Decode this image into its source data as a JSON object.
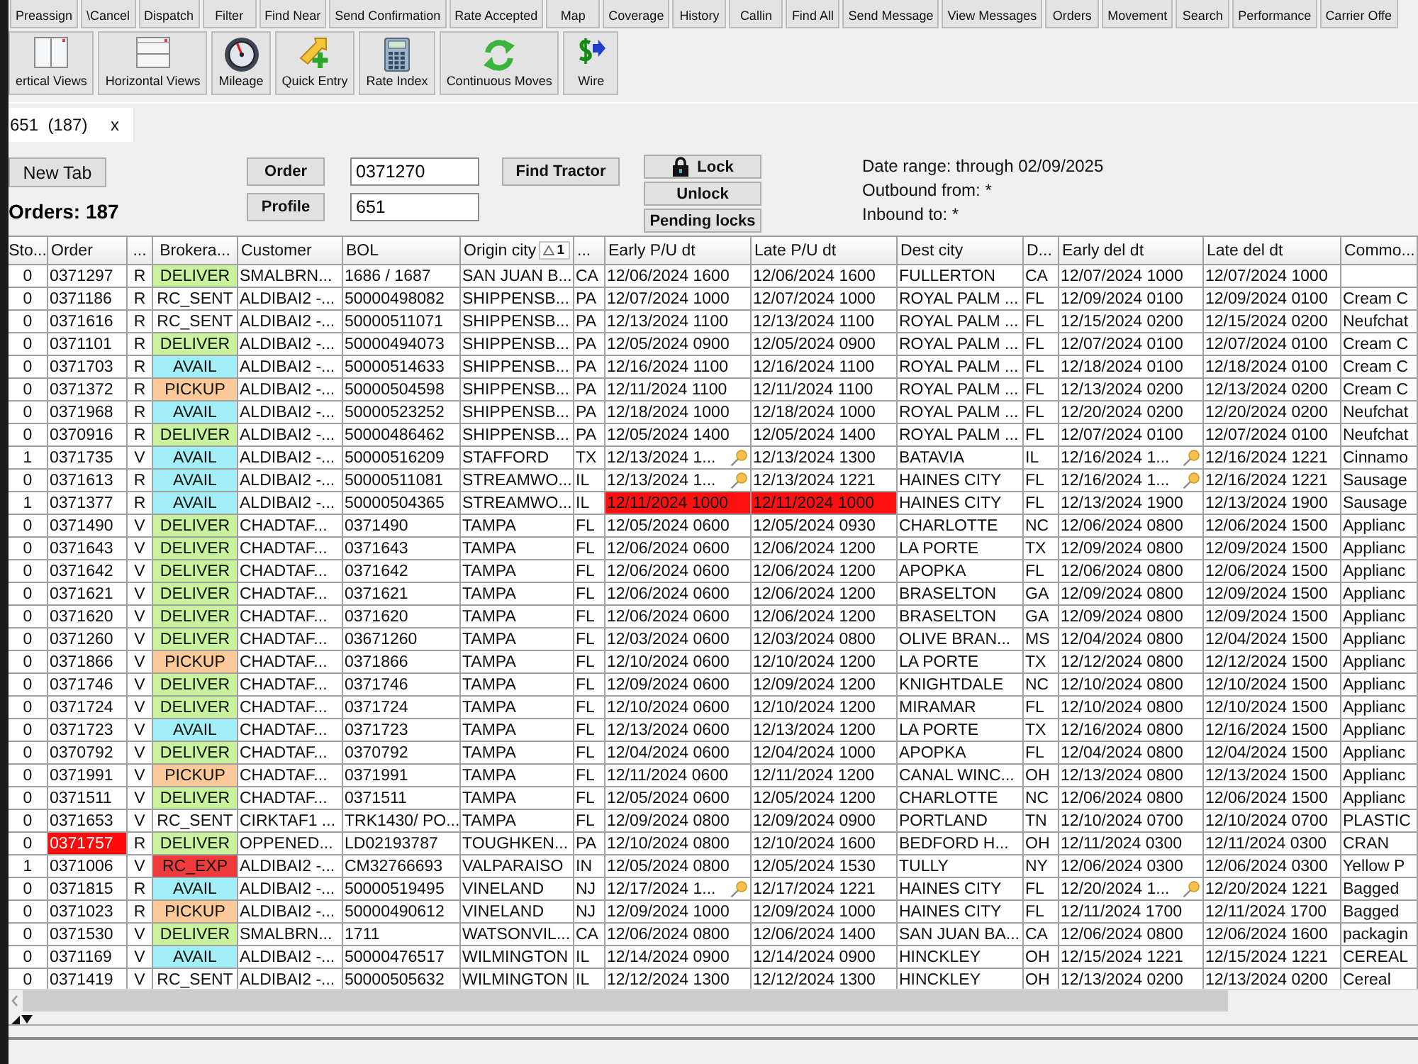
{
  "toolbar_top": {
    "buttons": [
      "Preassign",
      "\\Cancel",
      "Dispatch",
      "Filter",
      "Find Near",
      "Send Confirmation",
      "Rate Accepted",
      "Map",
      "Coverage",
      "History",
      "Callin",
      "Find All",
      "Send Message",
      "View Messages",
      "Orders",
      "Movement",
      "Search",
      "Performance",
      "Carrier Offe"
    ]
  },
  "toolbar_bottom": {
    "buttons": [
      {
        "label": "ertical Views",
        "kind": "vertical-views"
      },
      {
        "label": "Horizontal Views",
        "kind": "horizontal-views"
      },
      {
        "label": "Mileage",
        "kind": "mileage"
      },
      {
        "label": "Quick Entry",
        "kind": "quick-entry"
      },
      {
        "label": "Rate Index",
        "kind": "rate-index"
      },
      {
        "label": "Continuous Moves",
        "kind": "continuous-moves"
      },
      {
        "label": "Wire",
        "kind": "wire"
      }
    ]
  },
  "tabs": [
    {
      "label": "651  (187)",
      "close": "x",
      "selected": true
    }
  ],
  "panel": {
    "new_tab_button": "New Tab",
    "orders_count": "Orders: 187",
    "order_button": "Order",
    "order_value": "0371270",
    "profile_button": "Profile",
    "profile_value": "651",
    "find_tractor_button": "Find Tractor",
    "lock_buttons": [
      {
        "label": "Lock",
        "kind": "padlock"
      },
      {
        "label": "Unlock",
        "kind": "plain"
      },
      {
        "label": "Pending locks",
        "kind": "plain"
      }
    ],
    "date_info": [
      "Date range: through 02/09/2025",
      "Outbound from: *",
      "Inbound to: *"
    ]
  },
  "table": {
    "columns": [
      {
        "label": "Sto..."
      },
      {
        "label": "Order"
      },
      {
        "label": "..."
      },
      {
        "label": "Brokera..."
      },
      {
        "label": "Customer"
      },
      {
        "label": "BOL"
      },
      {
        "label": "Origin city",
        "sort": "1"
      },
      {
        "label": "..."
      },
      {
        "label": "Early P/U dt"
      },
      {
        "label": "Late P/U dt"
      },
      {
        "label": "Dest city"
      },
      {
        "label": "D..."
      },
      {
        "label": "Early del dt"
      },
      {
        "label": "Late del dt"
      },
      {
        "label": "Commo..."
      }
    ],
    "rows": [
      {
        "column_1": "0",
        "order": "0371297",
        "column_3": "R",
        "column_4": {
          "text": "DELIVER",
          "color": "#c8f29b"
        },
        "customer": "SMALBRN...",
        "bol": "1686 / 1687",
        "origin_city": "SAN JUAN B...",
        "column_8": "CA",
        "early_pu_dt": "12/06/2024 1600",
        "late_pu_dt": "12/06/2024 1600",
        "dest_city": "FULLERTON",
        "column_11": "CA",
        "early_del_dt": "12/07/2024 1000",
        "late_del_dt": "12/07/2024 1000",
        "order_flagged": false,
        "pu_flagged": false,
        "pu_pinned": false,
        "del_pinned": false
      },
      {
        "column_1": "0",
        "order": "0371186",
        "column_3": "R",
        "column_4": {
          "text": "RC_SENT",
          "color": "#ffffff"
        },
        "customer": "ALDIBAI2 -...",
        "bol": "50000498082",
        "origin_city": "SHIPPENSB...",
        "column_8": "PA",
        "early_pu_dt": "12/07/2024 1000",
        "late_pu_dt": "12/07/2024 1000",
        "dest_city": "ROYAL PALM ...",
        "column_11": "FL",
        "early_del_dt": "12/09/2024 0100",
        "late_del_dt": "12/09/2024 0100",
        "column_15": "Cream C",
        "order_flagged": false,
        "pu_flagged": false,
        "pu_pinned": false,
        "del_pinned": false
      },
      {
        "column_1": "0",
        "order": "0371616",
        "column_3": "R",
        "column_4": {
          "text": "RC_SENT",
          "color": "#ffffff"
        },
        "customer": "ALDIBAI2 -...",
        "bol": "50000511071",
        "origin_city": "SHIPPENSB...",
        "column_8": "PA",
        "early_pu_dt": "12/13/2024 1100",
        "late_pu_dt": "12/13/2024 1100",
        "dest_city": "ROYAL PALM ...",
        "column_11": "FL",
        "early_del_dt": "12/15/2024 0200",
        "late_del_dt": "12/15/2024 0200",
        "column_15": "Neufchat",
        "order_flagged": false,
        "pu_flagged": false,
        "pu_pinned": false,
        "del_pinned": false
      },
      {
        "column_1": "0",
        "order": "0371101",
        "column_3": "R",
        "column_4": {
          "text": "DELIVER",
          "color": "#c8f29b"
        },
        "customer": "ALDIBAI2 -...",
        "bol": "50000494073",
        "origin_city": "SHIPPENSB...",
        "column_8": "PA",
        "early_pu_dt": "12/05/2024 0900",
        "late_pu_dt": "12/05/2024 0900",
        "dest_city": "ROYAL PALM ...",
        "column_11": "FL",
        "early_del_dt": "12/07/2024 0100",
        "late_del_dt": "12/07/2024 0100",
        "column_15": "Cream C",
        "order_flagged": false,
        "pu_flagged": false,
        "pu_pinned": false,
        "del_pinned": false
      },
      {
        "column_1": "0",
        "order": "0371703",
        "column_3": "R",
        "column_4": {
          "text": "AVAIL",
          "color": "#a2eff8"
        },
        "customer": "ALDIBAI2 -...",
        "bol": "50000514633",
        "origin_city": "SHIPPENSB...",
        "column_8": "PA",
        "early_pu_dt": "12/16/2024 1100",
        "late_pu_dt": "12/16/2024 1100",
        "dest_city": "ROYAL PALM ...",
        "column_11": "FL",
        "early_del_dt": "12/18/2024 0100",
        "late_del_dt": "12/18/2024 0100",
        "column_15": "Cream C",
        "order_flagged": false,
        "pu_flagged": false,
        "pu_pinned": false,
        "del_pinned": false
      },
      {
        "column_1": "0",
        "order": "0371372",
        "column_3": "R",
        "column_4": {
          "text": "PICKUP",
          "color": "#fcc99a"
        },
        "customer": "ALDIBAI2 -...",
        "bol": "50000504598",
        "origin_city": "SHIPPENSB...",
        "column_8": "PA",
        "early_pu_dt": "12/11/2024 1100",
        "late_pu_dt": "12/11/2024 1100",
        "dest_city": "ROYAL PALM ...",
        "column_11": "FL",
        "early_del_dt": "12/13/2024 0200",
        "late_del_dt": "12/13/2024 0200",
        "column_15": "Cream C",
        "order_flagged": false,
        "pu_flagged": false,
        "pu_pinned": false,
        "del_pinned": false
      },
      {
        "column_1": "0",
        "order": "0371968",
        "column_3": "R",
        "column_4": {
          "text": "AVAIL",
          "color": "#a2eff8"
        },
        "customer": "ALDIBAI2 -...",
        "bol": "50000523252",
        "origin_city": "SHIPPENSB...",
        "column_8": "PA",
        "early_pu_dt": "12/18/2024 1000",
        "late_pu_dt": "12/18/2024 1000",
        "dest_city": "ROYAL PALM ...",
        "column_11": "FL",
        "early_del_dt": "12/20/2024 0200",
        "late_del_dt": "12/20/2024 0200",
        "column_15": "Neufchat",
        "order_flagged": false,
        "pu_flagged": false,
        "pu_pinned": false,
        "del_pinned": false
      },
      {
        "column_1": "0",
        "order": "0370916",
        "column_3": "R",
        "column_4": {
          "text": "DELIVER",
          "color": "#c8f29b"
        },
        "customer": "ALDIBAI2 -...",
        "bol": "50000486462",
        "origin_city": "SHIPPENSB...",
        "column_8": "PA",
        "early_pu_dt": "12/05/2024 1400",
        "late_pu_dt": "12/05/2024 1400",
        "dest_city": "ROYAL PALM ...",
        "column_11": "FL",
        "early_del_dt": "12/07/2024 0100",
        "late_del_dt": "12/07/2024 0100",
        "column_15": "Neufchat",
        "order_flagged": false,
        "pu_flagged": false,
        "pu_pinned": false,
        "del_pinned": false
      },
      {
        "column_1": "1",
        "order": "0371735",
        "column_3": "V",
        "column_4": {
          "text": "AVAIL",
          "color": "#a2eff8"
        },
        "customer": "ALDIBAI2 -...",
        "bol": "50000516209",
        "origin_city": "STAFFORD",
        "column_8": "TX",
        "early_pu_dt": "12/13/2024 1...",
        "late_pu_dt": "12/13/2024 1300",
        "dest_city": "BATAVIA",
        "column_11": "IL",
        "early_del_dt": "12/16/2024 1...",
        "late_del_dt": "12/16/2024 1221",
        "column_15": "Cinnamo",
        "order_flagged": false,
        "pu_flagged": false,
        "pu_pinned": true,
        "del_pinned": true
      },
      {
        "column_1": "0",
        "order": "0371613",
        "column_3": "R",
        "column_4": {
          "text": "AVAIL",
          "color": "#a2eff8"
        },
        "customer": "ALDIBAI2 -...",
        "bol": "50000511081",
        "origin_city": "STREAMWO...",
        "column_8": "IL",
        "early_pu_dt": "12/13/2024 1...",
        "late_pu_dt": "12/13/2024 1221",
        "dest_city": "HAINES CITY",
        "column_11": "FL",
        "early_del_dt": "12/16/2024 1...",
        "late_del_dt": "12/16/2024 1221",
        "column_15": "Sausage",
        "order_flagged": false,
        "pu_flagged": false,
        "pu_pinned": true,
        "del_pinned": true
      },
      {
        "column_1": "1",
        "order": "0371377",
        "column_3": "R",
        "column_4": {
          "text": "AVAIL",
          "color": "#a2eff8"
        },
        "customer": "ALDIBAI2 -...",
        "bol": "50000504365",
        "origin_city": "STREAMWO...",
        "column_8": "IL",
        "early_pu_dt": "12/11/2024 1000",
        "late_pu_dt": "12/11/2024 1000",
        "dest_city": "HAINES CITY",
        "column_11": "FL",
        "early_del_dt": "12/13/2024 1900",
        "late_del_dt": "12/13/2024 1900",
        "column_15": "Sausage",
        "order_flagged": false,
        "pu_flagged": true,
        "pu_pinned": false,
        "del_pinned": false
      },
      {
        "column_1": "0",
        "order": "0371490",
        "column_3": "V",
        "column_4": {
          "text": "DELIVER",
          "color": "#c8f29b"
        },
        "customer": "CHADTAF...",
        "bol": "0371490",
        "origin_city": "TAMPA",
        "column_8": "FL",
        "early_pu_dt": "12/05/2024 0600",
        "late_pu_dt": "12/05/2024 0930",
        "dest_city": "CHARLOTTE",
        "column_11": "NC",
        "early_del_dt": "12/06/2024 0800",
        "late_del_dt": "12/06/2024 1500",
        "column_15": "Applianc",
        "order_flagged": false,
        "pu_flagged": false,
        "pu_pinned": false,
        "del_pinned": false
      },
      {
        "column_1": "0",
        "order": "0371643",
        "column_3": "V",
        "column_4": {
          "text": "DELIVER",
          "color": "#c8f29b"
        },
        "customer": "CHADTAF...",
        "bol": "0371643",
        "origin_city": "TAMPA",
        "column_8": "FL",
        "early_pu_dt": "12/06/2024 0600",
        "late_pu_dt": "12/06/2024 1200",
        "dest_city": "LA PORTE",
        "column_11": "TX",
        "early_del_dt": "12/09/2024 0800",
        "late_del_dt": "12/09/2024 1500",
        "column_15": "Applianc",
        "order_flagged": false,
        "pu_flagged": false,
        "pu_pinned": false,
        "del_pinned": false
      },
      {
        "column_1": "0",
        "order": "0371642",
        "column_3": "V",
        "column_4": {
          "text": "DELIVER",
          "color": "#c8f29b"
        },
        "customer": "CHADTAF...",
        "bol": "0371642",
        "origin_city": "TAMPA",
        "column_8": "FL",
        "early_pu_dt": "12/06/2024 0600",
        "late_pu_dt": "12/06/2024 1200",
        "dest_city": "APOPKA",
        "column_11": "FL",
        "early_del_dt": "12/06/2024 0800",
        "late_del_dt": "12/06/2024 1500",
        "column_15": "Applianc",
        "order_flagged": false,
        "pu_flagged": false,
        "pu_pinned": false,
        "del_pinned": false
      },
      {
        "column_1": "0",
        "order": "0371621",
        "column_3": "V",
        "column_4": {
          "text": "DELIVER",
          "color": "#c8f29b"
        },
        "customer": "CHADTAF...",
        "bol": "0371621",
        "origin_city": "TAMPA",
        "column_8": "FL",
        "early_pu_dt": "12/06/2024 0600",
        "late_pu_dt": "12/06/2024 1200",
        "dest_city": "BRASELTON",
        "column_11": "GA",
        "early_del_dt": "12/09/2024 0800",
        "late_del_dt": "12/09/2024 1500",
        "column_15": "Applianc",
        "order_flagged": false,
        "pu_flagged": false,
        "pu_pinned": false,
        "del_pinned": false
      },
      {
        "column_1": "0",
        "order": "0371620",
        "column_3": "V",
        "column_4": {
          "text": "DELIVER",
          "color": "#c8f29b"
        },
        "customer": "CHADTAF...",
        "bol": "0371620",
        "origin_city": "TAMPA",
        "column_8": "FL",
        "early_pu_dt": "12/06/2024 0600",
        "late_pu_dt": "12/06/2024 1200",
        "dest_city": "BRASELTON",
        "column_11": "GA",
        "early_del_dt": "12/09/2024 0800",
        "late_del_dt": "12/09/2024 1500",
        "column_15": "Applianc",
        "order_flagged": false,
        "pu_flagged": false,
        "pu_pinned": false,
        "del_pinned": false
      },
      {
        "column_1": "0",
        "order": "0371260",
        "column_3": "V",
        "column_4": {
          "text": "DELIVER",
          "color": "#c8f29b"
        },
        "customer": "CHADTAF...",
        "bol": "03671260",
        "origin_city": "TAMPA",
        "column_8": "FL",
        "early_pu_dt": "12/03/2024 0600",
        "late_pu_dt": "12/03/2024 0800",
        "dest_city": "OLIVE BRAN...",
        "column_11": "MS",
        "early_del_dt": "12/04/2024 0800",
        "late_del_dt": "12/04/2024 1500",
        "column_15": "Applianc",
        "order_flagged": false,
        "pu_flagged": false,
        "pu_pinned": false,
        "del_pinned": false
      },
      {
        "column_1": "0",
        "order": "0371866",
        "column_3": "V",
        "column_4": {
          "text": "PICKUP",
          "color": "#fcc99a"
        },
        "customer": "CHADTAF...",
        "bol": "0371866",
        "origin_city": "TAMPA",
        "column_8": "FL",
        "early_pu_dt": "12/10/2024 0600",
        "late_pu_dt": "12/10/2024 1200",
        "dest_city": "LA PORTE",
        "column_11": "TX",
        "early_del_dt": "12/12/2024 0800",
        "late_del_dt": "12/12/2024 1500",
        "column_15": "Applianc",
        "order_flagged": false,
        "pu_flagged": false,
        "pu_pinned": false,
        "del_pinned": false
      },
      {
        "column_1": "0",
        "order": "0371746",
        "column_3": "V",
        "column_4": {
          "text": "DELIVER",
          "color": "#c8f29b"
        },
        "customer": "CHADTAF...",
        "bol": "0371746",
        "origin_city": "TAMPA",
        "column_8": "FL",
        "early_pu_dt": "12/09/2024 0600",
        "late_pu_dt": "12/09/2024 1200",
        "dest_city": "KNIGHTDALE",
        "column_11": "NC",
        "early_del_dt": "12/10/2024 0800",
        "late_del_dt": "12/10/2024 1500",
        "column_15": "Applianc",
        "order_flagged": false,
        "pu_flagged": false,
        "pu_pinned": false,
        "del_pinned": false
      },
      {
        "column_1": "0",
        "order": "0371724",
        "column_3": "V",
        "column_4": {
          "text": "DELIVER",
          "color": "#c8f29b"
        },
        "customer": "CHADTAF...",
        "bol": "0371724",
        "origin_city": "TAMPA",
        "column_8": "FL",
        "early_pu_dt": "12/10/2024 0600",
        "late_pu_dt": "12/10/2024 1200",
        "dest_city": "MIRAMAR",
        "column_11": "FL",
        "early_del_dt": "12/10/2024 0800",
        "late_del_dt": "12/10/2024 1500",
        "column_15": "Applianc",
        "order_flagged": false,
        "pu_flagged": false,
        "pu_pinned": false,
        "del_pinned": false
      },
      {
        "column_1": "0",
        "order": "0371723",
        "column_3": "V",
        "column_4": {
          "text": "AVAIL",
          "color": "#a2eff8"
        },
        "customer": "CHADTAF...",
        "bol": "0371723",
        "origin_city": "TAMPA",
        "column_8": "FL",
        "early_pu_dt": "12/13/2024 0600",
        "late_pu_dt": "12/13/2024 1200",
        "dest_city": "LA PORTE",
        "column_11": "TX",
        "early_del_dt": "12/16/2024 0800",
        "late_del_dt": "12/16/2024 1500",
        "column_15": "Applianc",
        "order_flagged": false,
        "pu_flagged": false,
        "pu_pinned": false,
        "del_pinned": false
      },
      {
        "column_1": "0",
        "order": "0370792",
        "column_3": "V",
        "column_4": {
          "text": "DELIVER",
          "color": "#c8f29b"
        },
        "customer": "CHADTAF...",
        "bol": "0370792",
        "origin_city": "TAMPA",
        "column_8": "FL",
        "early_pu_dt": "12/04/2024 0600",
        "late_pu_dt": "12/04/2024 1000",
        "dest_city": "APOPKA",
        "column_11": "FL",
        "early_del_dt": "12/04/2024 0800",
        "late_del_dt": "12/04/2024 1500",
        "column_15": "Applianc",
        "order_flagged": false,
        "pu_flagged": false,
        "pu_pinned": false,
        "del_pinned": false
      },
      {
        "column_1": "0",
        "order": "0371991",
        "column_3": "V",
        "column_4": {
          "text": "PICKUP",
          "color": "#fcc99a"
        },
        "customer": "CHADTAF...",
        "bol": "0371991",
        "origin_city": "TAMPA",
        "column_8": "FL",
        "early_pu_dt": "12/11/2024 0600",
        "late_pu_dt": "12/11/2024 1200",
        "dest_city": "CANAL WINC...",
        "column_11": "OH",
        "early_del_dt": "12/13/2024 0800",
        "late_del_dt": "12/13/2024 1500",
        "column_15": "Applianc",
        "order_flagged": false,
        "pu_flagged": false,
        "pu_pinned": false,
        "del_pinned": false
      },
      {
        "column_1": "0",
        "order": "0371511",
        "column_3": "V",
        "column_4": {
          "text": "DELIVER",
          "color": "#c8f29b"
        },
        "customer": "CHADTAF...",
        "bol": "0371511",
        "origin_city": "TAMPA",
        "column_8": "FL",
        "early_pu_dt": "12/05/2024 0600",
        "late_pu_dt": "12/05/2024 1200",
        "dest_city": "CHARLOTTE",
        "column_11": "NC",
        "early_del_dt": "12/06/2024 0800",
        "late_del_dt": "12/06/2024 1500",
        "column_15": "Applianc",
        "order_flagged": false,
        "pu_flagged": false,
        "pu_pinned": false,
        "del_pinned": false
      },
      {
        "column_1": "0",
        "order": "0371653",
        "column_3": "V",
        "column_4": {
          "text": "RC_SENT",
          "color": "#ffffff"
        },
        "customer": "CIRKTAF1 ...",
        "bol": "TRK1430/ PO...",
        "origin_city": "TAMPA",
        "column_8": "FL",
        "early_pu_dt": "12/09/2024 0800",
        "late_pu_dt": "12/09/2024 0900",
        "dest_city": "PORTLAND",
        "column_11": "TN",
        "early_del_dt": "12/10/2024 0700",
        "late_del_dt": "12/10/2024 0700",
        "column_15": "PLASTIC",
        "order_flagged": false,
        "pu_flagged": false,
        "pu_pinned": false,
        "del_pinned": false
      },
      {
        "column_1": "0",
        "order": "0371757",
        "column_3": "R",
        "column_4": {
          "text": "DELIVER",
          "color": "#c8f29b"
        },
        "customer": "OPPENED...",
        "bol": "LD02193787",
        "origin_city": "TOUGHKEN...",
        "column_8": "PA",
        "early_pu_dt": "12/10/2024 0800",
        "late_pu_dt": "12/10/2024 1600",
        "dest_city": "BEDFORD H...",
        "column_11": "OH",
        "early_del_dt": "12/11/2024 0300",
        "late_del_dt": "12/11/2024 0300",
        "column_15": "CRAN",
        "order_flagged": true,
        "pu_flagged": false,
        "pu_pinned": false,
        "del_pinned": false
      },
      {
        "column_1": "1",
        "order": "0371006",
        "column_3": "V",
        "column_4": {
          "text": "RC_EXP",
          "color": "#ef3b3b"
        },
        "customer": "ALDIBAI2 -...",
        "bol": "CM32766693",
        "origin_city": "VALPARAISO",
        "column_8": "IN",
        "early_pu_dt": "12/05/2024 0800",
        "late_pu_dt": "12/05/2024 1530",
        "dest_city": "TULLY",
        "column_11": "NY",
        "early_del_dt": "12/06/2024 0300",
        "late_del_dt": "12/06/2024 0300",
        "column_15": "Yellow P",
        "order_flagged": false,
        "pu_flagged": false,
        "pu_pinned": false,
        "del_pinned": false
      },
      {
        "column_1": "0",
        "order": "0371815",
        "column_3": "R",
        "column_4": {
          "text": "AVAIL",
          "color": "#a2eff8"
        },
        "customer": "ALDIBAI2 -...",
        "bol": "50000519495",
        "origin_city": "VINELAND",
        "column_8": "NJ",
        "early_pu_dt": "12/17/2024 1...",
        "late_pu_dt": "12/17/2024 1221",
        "dest_city": "HAINES CITY",
        "column_11": "FL",
        "early_del_dt": "12/20/2024 1...",
        "late_del_dt": "12/20/2024 1221",
        "column_15": "Bagged",
        "order_flagged": false,
        "pu_flagged": false,
        "pu_pinned": true,
        "del_pinned": true
      },
      {
        "column_1": "0",
        "order": "0371023",
        "column_3": "R",
        "column_4": {
          "text": "PICKUP",
          "color": "#fcc99a"
        },
        "customer": "ALDIBAI2 -...",
        "bol": "50000490612",
        "origin_city": "VINELAND",
        "column_8": "NJ",
        "early_pu_dt": "12/09/2024 1000",
        "late_pu_dt": "12/09/2024 1000",
        "dest_city": "HAINES CITY",
        "column_11": "FL",
        "early_del_dt": "12/11/2024 1700",
        "late_del_dt": "12/11/2024 1700",
        "column_15": "Bagged",
        "order_flagged": false,
        "pu_flagged": false,
        "pu_pinned": false,
        "del_pinned": false
      },
      {
        "column_1": "0",
        "order": "0371530",
        "column_3": "V",
        "column_4": {
          "text": "DELIVER",
          "color": "#c8f29b"
        },
        "customer": "SMALBRN...",
        "bol": "1711",
        "origin_city": "WATSONVIL...",
        "column_8": "CA",
        "early_pu_dt": "12/06/2024 0800",
        "late_pu_dt": "12/06/2024 1400",
        "dest_city": "SAN JUAN BA...",
        "column_11": "CA",
        "early_del_dt": "12/06/2024 0800",
        "late_del_dt": "12/06/2024 1600",
        "column_15": "packagin",
        "order_flagged": false,
        "pu_flagged": false,
        "pu_pinned": false,
        "del_pinned": false
      },
      {
        "column_1": "0",
        "order": "0371169",
        "column_3": "V",
        "column_4": {
          "text": "AVAIL",
          "color": "#a2eff8"
        },
        "customer": "ALDIBAI2 -...",
        "bol": "50000476517",
        "origin_city": "WILMINGTON",
        "column_8": "IL",
        "early_pu_dt": "12/14/2024 0900",
        "late_pu_dt": "12/14/2024 0900",
        "dest_city": "HINCKLEY",
        "column_11": "OH",
        "early_del_dt": "12/15/2024 1221",
        "late_del_dt": "12/15/2024 1221",
        "column_15": "CEREAL",
        "order_flagged": false,
        "pu_flagged": false,
        "pu_pinned": false,
        "del_pinned": false
      },
      {
        "column_1": "0",
        "order": "0371419",
        "column_3": "V",
        "column_4": {
          "text": "RC_SENT",
          "color": "#ffffff"
        },
        "customer": "ALDIBAI2 -...",
        "bol": "50000505632",
        "origin_city": "WILMINGTON",
        "column_8": "IL",
        "early_pu_dt": "12/12/2024 1300",
        "late_pu_dt": "12/12/2024 1300",
        "dest_city": "HINCKLEY",
        "column_11": "OH",
        "early_del_dt": "12/13/2024 0200",
        "late_del_dt": "12/13/2024 0200",
        "column_15": "Cereal",
        "order_flagged": false,
        "pu_flagged": false,
        "pu_pinned": false,
        "del_pinned": false
      }
    ]
  }
}
